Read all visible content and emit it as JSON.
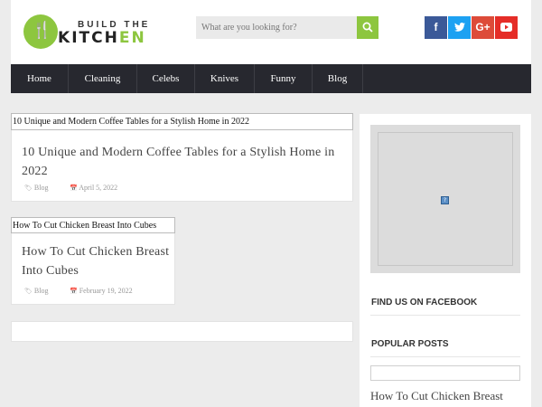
{
  "brand": {
    "top": "BUILD THE",
    "bottom_k": "K",
    "bottom_it": "IT",
    "bottom_ch": "CH",
    "bottom_en": "EN",
    "accent": "#8dc63f"
  },
  "search": {
    "placeholder": "What are you looking for?",
    "icon": "search-icon"
  },
  "social": [
    {
      "name": "facebook-icon",
      "glyph": "f",
      "color": "#3b5998"
    },
    {
      "name": "twitter-icon",
      "glyph": "t",
      "color": "#1da1f2"
    },
    {
      "name": "google-plus-icon",
      "glyph": "G+",
      "color": "#dd4b39"
    },
    {
      "name": "youtube-icon",
      "glyph": "▶",
      "color": "#e52d27"
    }
  ],
  "nav": {
    "items": [
      "Home",
      "Cleaning",
      "Celebs",
      "Knives",
      "Funny",
      "Blog"
    ]
  },
  "posts": [
    {
      "label": "10 Unique and Modern Coffee Tables for a Stylish Home in 2022",
      "title": "10 Unique and Modern Coffee Tables for a Stylish Home in 2022",
      "category": "Blog",
      "date": "April 5, 2022"
    },
    {
      "label": "How To Cut Chicken Breast Into Cubes",
      "title": "How To Cut Chicken Breast Into Cubes",
      "category": "Blog",
      "date": "February 19, 2022"
    }
  ],
  "sidebar": {
    "ad_icon": "?",
    "facebook_title": "FIND US ON FACEBOOK",
    "popular_title": "POPULAR POSTS",
    "popular_first": "How To Cut Chicken Breast Into Cubes"
  }
}
